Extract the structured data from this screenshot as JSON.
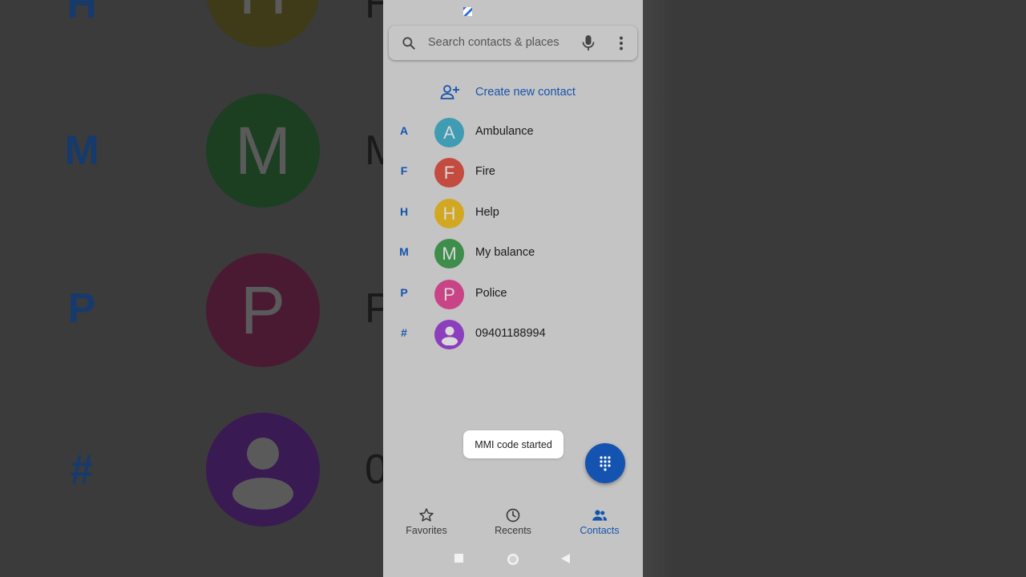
{
  "background": {
    "rows": [
      {
        "letter": "H",
        "avatar_letter": "H",
        "avatar_color": "#3f3a17",
        "text": "H"
      },
      {
        "letter": "M",
        "avatar_letter": "M",
        "avatar_color": "#1c3f22",
        "text": "M"
      },
      {
        "letter": "P",
        "avatar_letter": "P",
        "avatar_color": "#4a1a33",
        "text": "P"
      },
      {
        "letter": "#",
        "avatar_letter": "",
        "avatar_color": "#3a1a52",
        "text": "0"
      }
    ]
  },
  "search": {
    "placeholder": "Search contacts & places",
    "value": ""
  },
  "create": {
    "label": "Create new contact"
  },
  "contacts": [
    {
      "letter": "A",
      "initial": "A",
      "name": "Ambulance",
      "color": "#3f9cb3"
    },
    {
      "letter": "F",
      "initial": "F",
      "name": "Fire",
      "color": "#c34b40"
    },
    {
      "letter": "H",
      "initial": "H",
      "name": "Help",
      "color": "#d2a823"
    },
    {
      "letter": "M",
      "initial": "M",
      "name": "My balance",
      "color": "#3f8d4b"
    },
    {
      "letter": "P",
      "initial": "P",
      "name": "Police",
      "color": "#c94487"
    },
    {
      "letter": "#",
      "initial": "",
      "name": "09401188994",
      "color": "#8c3fbc",
      "icon": "person-icon"
    }
  ],
  "toast": {
    "text": "MMI code started"
  },
  "nav": {
    "items": [
      {
        "label": "Favorites",
        "icon": "star-icon",
        "active": false
      },
      {
        "label": "Recents",
        "icon": "clock-icon",
        "active": false
      },
      {
        "label": "Contacts",
        "icon": "people-icon",
        "active": true
      }
    ]
  },
  "colors": {
    "accent": "#1554ae",
    "fab": "#1454b0"
  }
}
